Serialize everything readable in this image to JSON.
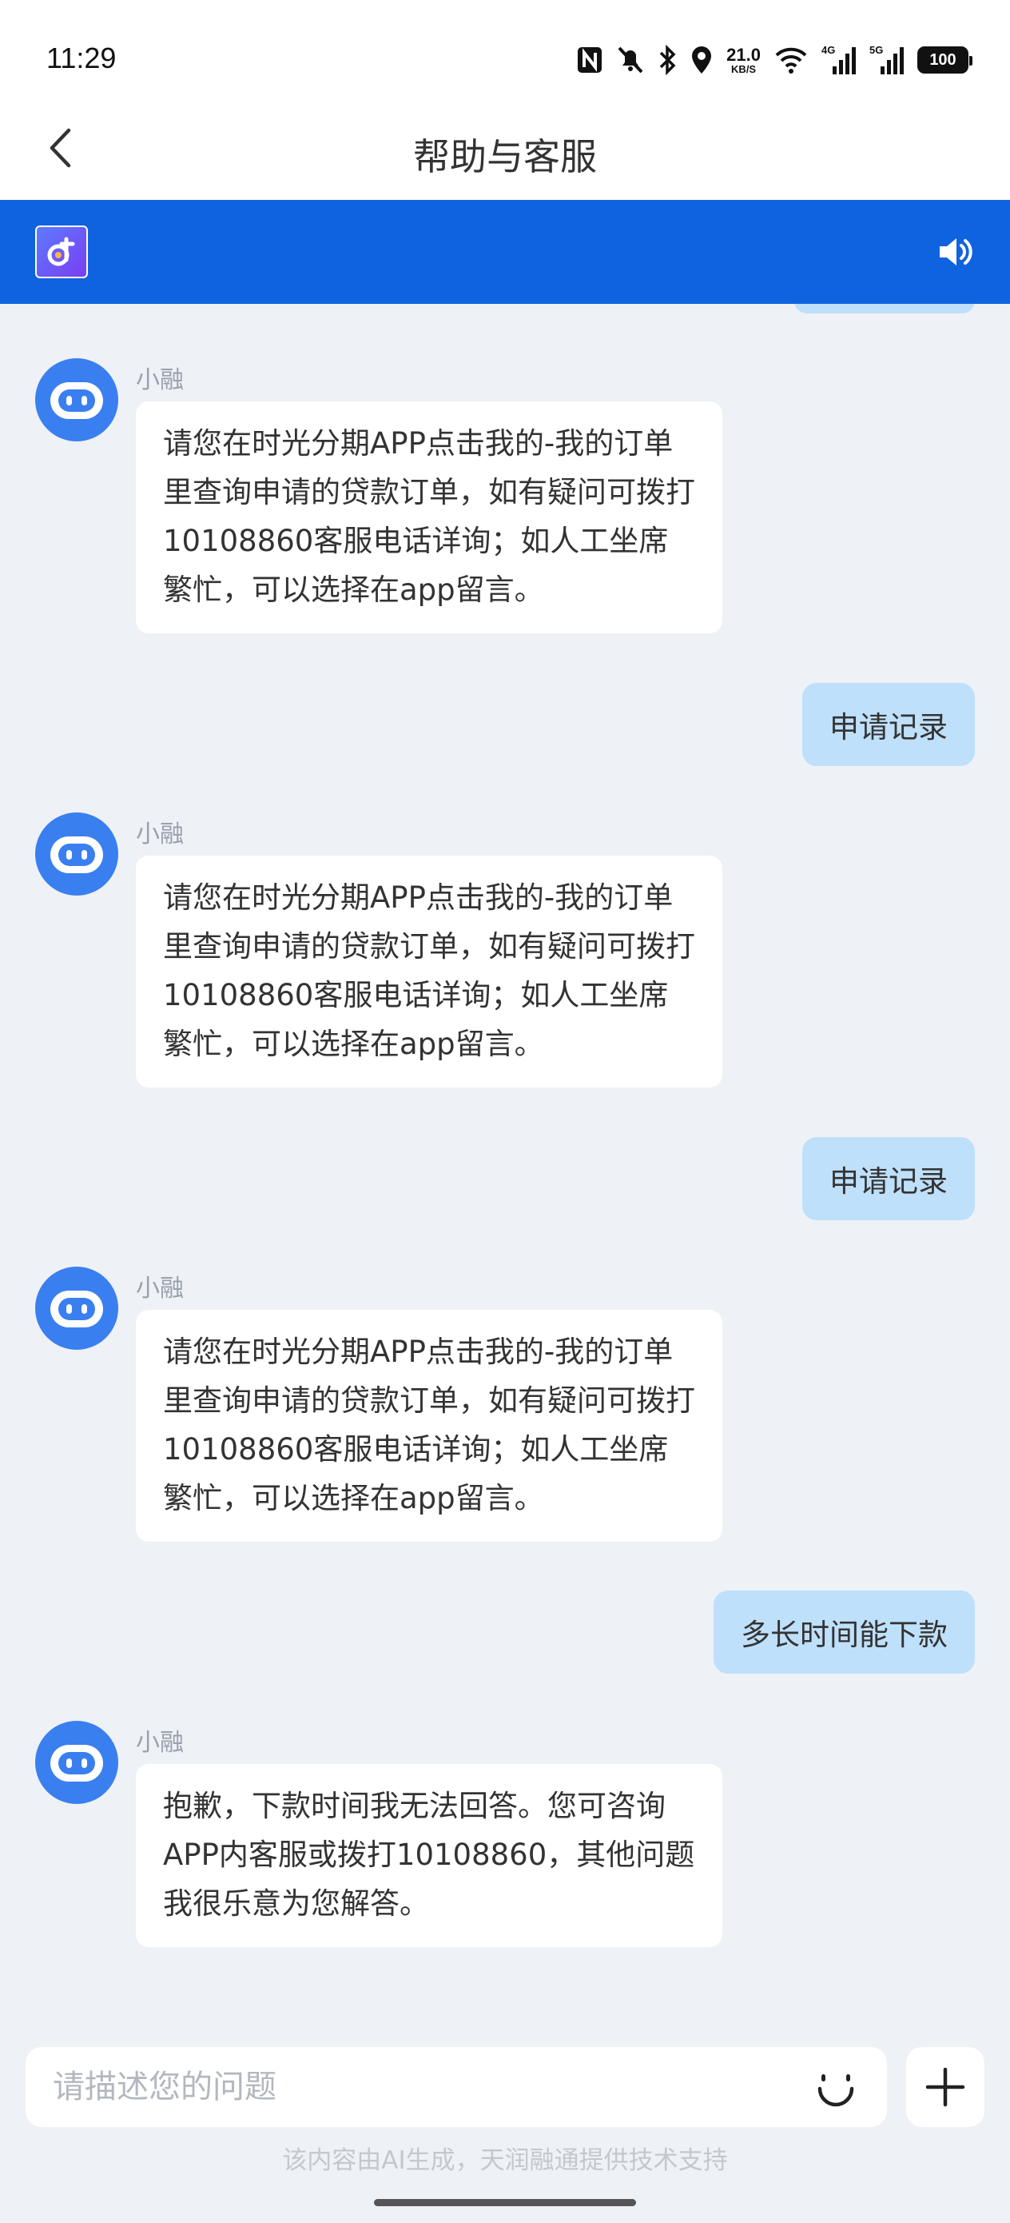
{
  "status_bar": {
    "time": "11:29",
    "net_speed_value": "21.0",
    "net_speed_unit": "KB/S",
    "net_4g": "4G",
    "net_5g": "5G",
    "battery": "100"
  },
  "nav": {
    "title": "帮助与客服"
  },
  "header": {
    "brand_color": "#1063de"
  },
  "chat": {
    "bot_name": "小融",
    "messages": [
      {
        "from": "bot",
        "name": "小融",
        "text": "请您在时光分期APP点击我的-我的订单里查询申请的贷款订单，如有疑问可拨打10108860客服电话详询；如人工坐席繁忙，可以选择在app留言。"
      },
      {
        "from": "user",
        "text": "申请记录"
      },
      {
        "from": "bot",
        "name": "小融",
        "text": "请您在时光分期APP点击我的-我的订单里查询申请的贷款订单，如有疑问可拨打10108860客服电话详询；如人工坐席繁忙，可以选择在app留言。"
      },
      {
        "from": "user",
        "text": "申请记录"
      },
      {
        "from": "bot",
        "name": "小融",
        "text": "请您在时光分期APP点击我的-我的订单里查询申请的贷款订单，如有疑问可拨打10108860客服电话详询；如人工坐席繁忙，可以选择在app留言。"
      },
      {
        "from": "user",
        "text": "多长时间能下款"
      },
      {
        "from": "bot",
        "name": "小融",
        "text": "抱歉，下款时间我无法回答。您可咨询APP内客服或拨打10108860，其他问题我很乐意为您解答。"
      }
    ]
  },
  "input": {
    "placeholder": "请描述您的问题",
    "value": ""
  },
  "footer": {
    "disclaimer": "该内容由AI生成，天润融通提供技术支持"
  },
  "colors": {
    "user_bubble": "#bfe0fb",
    "bot_bubble": "#ffffff",
    "avatar": "#3a7ff0",
    "chat_background": "#eef1f6"
  }
}
